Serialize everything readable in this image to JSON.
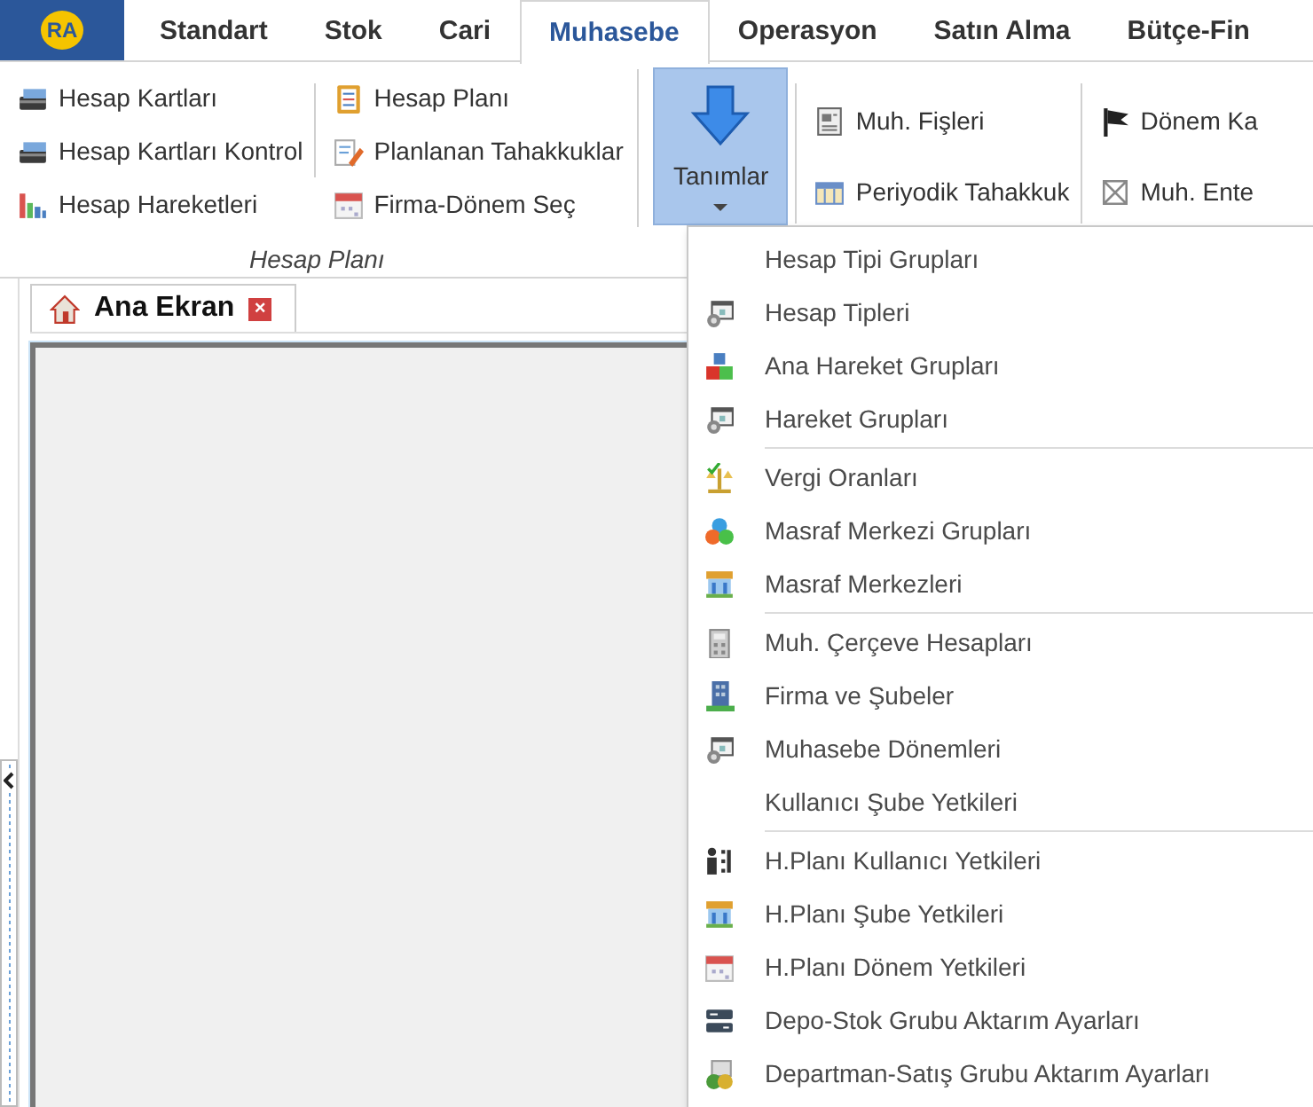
{
  "app_logo": {
    "text": "RA"
  },
  "tabs": [
    {
      "label": "Standart",
      "selected": false
    },
    {
      "label": "Stok",
      "selected": false
    },
    {
      "label": "Cari",
      "selected": false
    },
    {
      "label": "Muhasebe",
      "selected": true
    },
    {
      "label": "Operasyon",
      "selected": false
    },
    {
      "label": "Satın Alma",
      "selected": false
    },
    {
      "label": "Bütçe-Fin",
      "selected": false
    }
  ],
  "ribbon": {
    "group": {
      "label": "Hesap Planı",
      "columns": [
        [
          "Hesap Kartları",
          "Hesap Kartları Kontrol",
          "Hesap Hareketleri"
        ],
        [
          "Hesap Planı",
          "Planlanan Tahakkuklar",
          "Firma-Dönem Seç"
        ]
      ]
    },
    "dropdown_button": {
      "label": "Tanımlar",
      "expanded": true
    },
    "columns": [
      [
        "Muh. Fişleri",
        "Periyodik Tahakkuk"
      ],
      [
        "Dönem Ka",
        "Muh. Ente"
      ]
    ]
  },
  "dropdown_menu": {
    "sections": [
      [
        "Hesap Tipi Grupları",
        "Hesap Tipleri",
        "Ana Hareket Grupları",
        "Hareket Grupları"
      ],
      [
        "Vergi Oranları",
        "Masraf Merkezi Grupları",
        "Masraf Merkezleri"
      ],
      [
        "Muh. Çerçeve Hesapları",
        "Firma ve Şubeler",
        "Muhasebe Dönemleri",
        "Kullanıcı Şube Yetkileri"
      ],
      [
        "H.Planı Kullanıcı Yetkileri",
        "H.Planı Şube Yetkileri",
        "H.Planı Dönem Yetkileri",
        "Depo-Stok Grubu Aktarım Ayarları",
        "Departman-Satış Grubu Aktarım Ayarları"
      ]
    ]
  },
  "document_tab": {
    "label": "Ana Ekran",
    "close": "×"
  }
}
